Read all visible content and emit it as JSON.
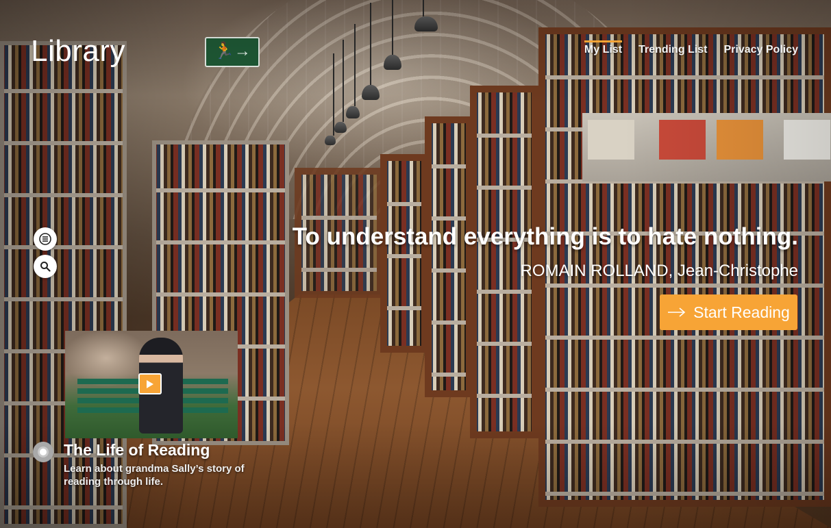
{
  "brand": {
    "name": "Library"
  },
  "nav": {
    "items": [
      {
        "label": "My List",
        "active": true
      },
      {
        "label": "Trending List",
        "active": false
      },
      {
        "label": "Privacy Policy",
        "active": false
      }
    ]
  },
  "sidebar": {
    "menu_icon": "menu-icon",
    "search_icon": "search-icon"
  },
  "hero": {
    "quote": "To understand everything is to hate nothing.",
    "attribution": "ROMAIN ROLLAND, Jean-Christophe",
    "cta_label": "Start Reading",
    "cta_icon": "arrow-right-icon"
  },
  "feature": {
    "title": "The Life of Reading",
    "description": "Learn about grandma Sally’s story of reading through life.",
    "play_icon": "play-icon"
  },
  "colors": {
    "accent": "#f7a436",
    "text": "#ffffff"
  }
}
